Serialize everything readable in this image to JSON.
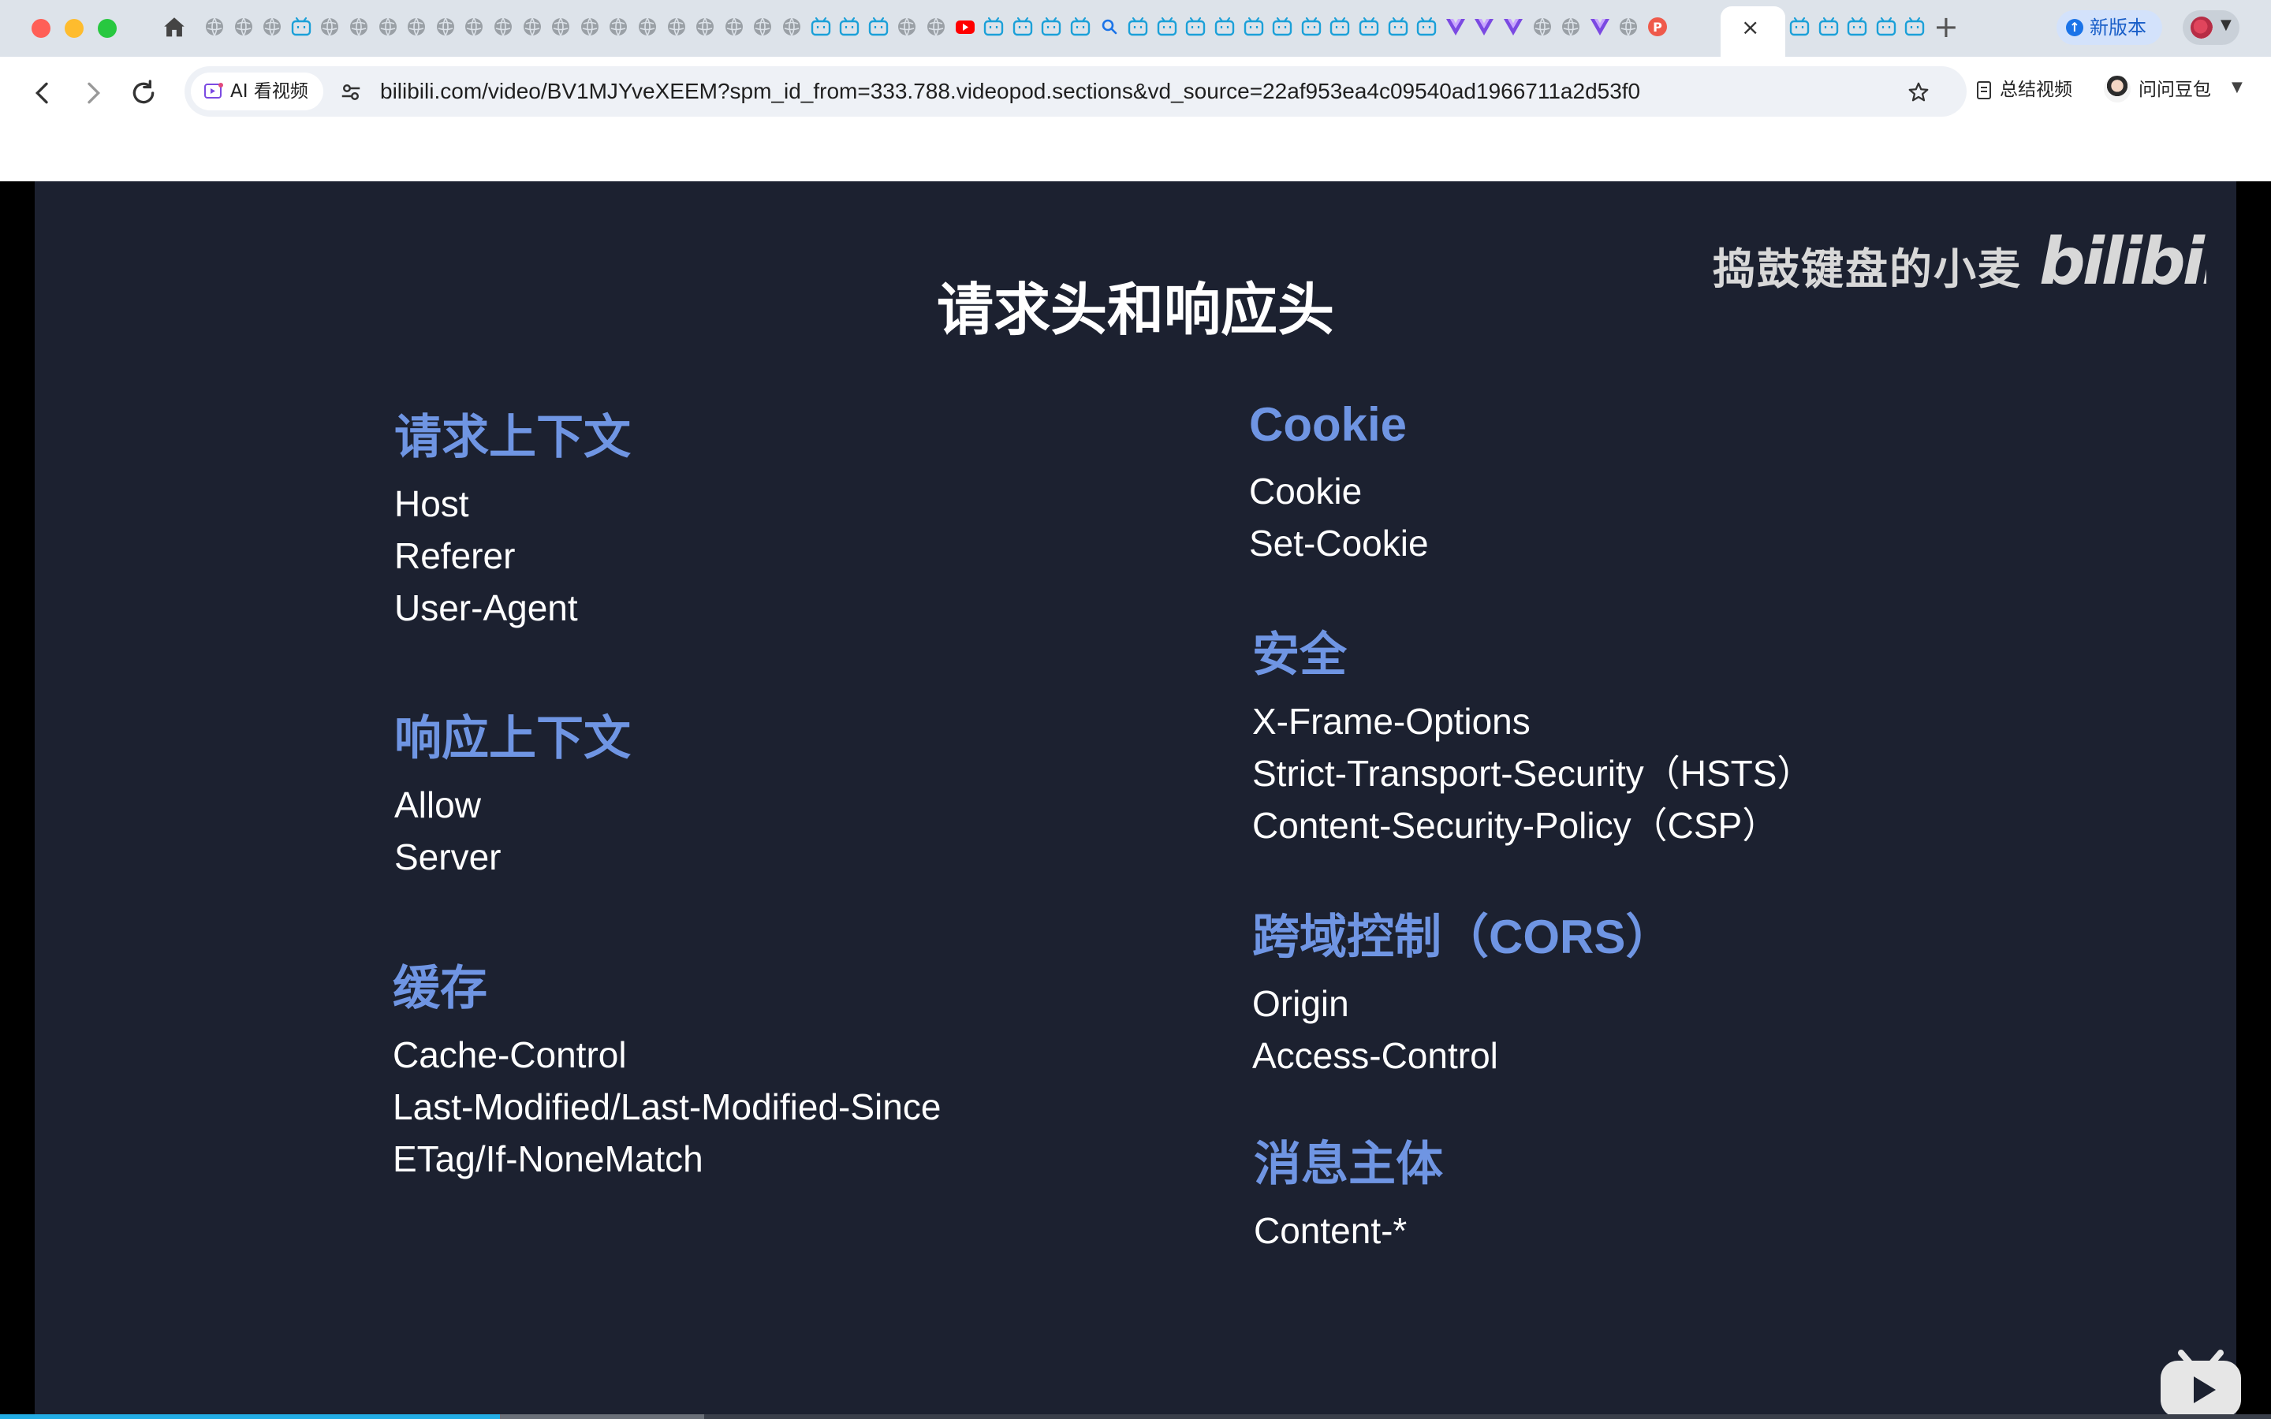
{
  "browser": {
    "active_tab_close": "×",
    "new_tab": "+",
    "update_button": "新版本",
    "tab_icons": [
      "globe",
      "globe",
      "globe",
      "bilibili",
      "globe",
      "globe",
      "globe",
      "globe",
      "globe",
      "globe",
      "globe",
      "globe",
      "globe",
      "globe",
      "globe",
      "globe",
      "globe",
      "globe",
      "globe",
      "globe",
      "globe",
      "bilibili",
      "bilibili",
      "bilibili",
      "globe",
      "globe",
      "youtube",
      "bilibili",
      "bilibili",
      "bilibili",
      "bilibili",
      "search",
      "bilibili",
      "bilibili",
      "bilibili",
      "bilibili",
      "bilibili",
      "bilibili",
      "bilibili",
      "bilibili",
      "bilibili",
      "bilibili",
      "bilibili",
      "vue",
      "vue",
      "vue",
      "globe",
      "globe",
      "vue",
      "globe",
      "p-red"
    ],
    "tab_icons_after_active": [
      "bilibili",
      "bilibili",
      "bilibili",
      "bilibili",
      "bilibili"
    ]
  },
  "toolbar": {
    "ai_chip_label": "AI 看视频",
    "url": "bilibili.com/video/BV1MJYveXEEM?spm_id_from=333.788.videopod.sections&vd_source=22af953ea4c09540ad1966711a2d53f0",
    "summary_button": "总结视频",
    "doubao_button": "问问豆包"
  },
  "slide": {
    "title": "请求头和响应头",
    "watermark_author": "捣鼓键盘的小麦",
    "watermark_logo": "bilibili",
    "left_sections": [
      {
        "heading": "请求上下文",
        "items": [
          "Host",
          "Referer",
          "User-Agent"
        ]
      },
      {
        "heading": "响应上下文",
        "items": [
          "Allow",
          "Server"
        ]
      },
      {
        "heading": "缓存",
        "items": [
          "Cache-Control",
          "Last-Modified/Last-Modified-Since",
          "ETag/If-NoneMatch"
        ]
      }
    ],
    "right_sections": [
      {
        "heading": "Cookie",
        "items": [
          "Cookie",
          "Set-Cookie"
        ]
      },
      {
        "heading": "安全",
        "items": [
          "X-Frame-Options",
          "Strict-Transport-Security（HSTS）",
          "Content-Security-Policy（CSP）"
        ]
      },
      {
        "heading": "跨域控制（CORS）",
        "items": [
          "Origin",
          "Access-Control"
        ]
      },
      {
        "heading": "消息主体",
        "items": [
          "Content-*"
        ]
      }
    ]
  },
  "player": {
    "progress_fraction": 0.22,
    "buffered_fraction": 0.31
  },
  "colors": {
    "slide_background": "#1c2130",
    "heading_blue": "#6f95e3",
    "progress_blue": "#23ade5"
  }
}
